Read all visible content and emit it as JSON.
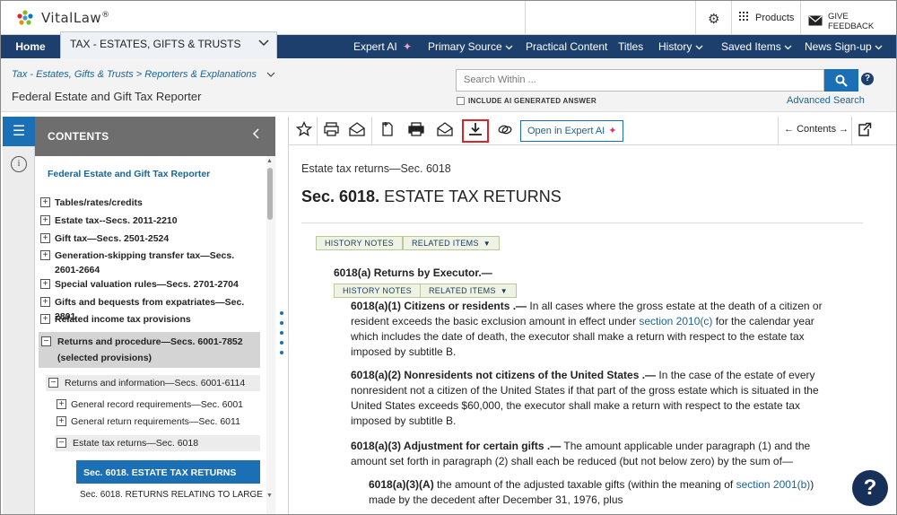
{
  "brand": {
    "name": "VitalLaw",
    "reg": "®"
  },
  "header": {
    "products_label": "Products",
    "feedback_label": "GIVE FEEDBACK"
  },
  "nav": {
    "home": "Home",
    "practice_area": "TAX - ESTATES, GIFTS & TRUSTS",
    "items": [
      "Expert AI",
      "Primary Source",
      "Practical Content",
      "Titles",
      "History",
      "Saved Items",
      "News Sign-up"
    ]
  },
  "subheader": {
    "breadcrumb": "Tax - Estates, Gifts & Trusts > Reporters & Explanations",
    "doc_title": "Federal Estate and Gift Tax Reporter",
    "search_placeholder": "Search Within ...",
    "ai_checkbox_label": "INCLUDE AI GENERATED ANSWER",
    "advanced_search": "Advanced Search"
  },
  "toc": {
    "heading": "CONTENTS",
    "root": "Federal Estate and Gift Tax Reporter",
    "items": [
      "Tables/rates/credits",
      "Estate tax--Secs. 2011-2210",
      "Gift tax—Secs. 2501-2524",
      "Generation-skipping transfer tax—Secs. 2601-2664",
      "Special valuation rules—Secs. 2701-2704",
      "Gifts and bequests from expatriates—Sec. 2801",
      "Related income tax provisions",
      "Returns and procedure—Secs. 6001-7852 (selected provisions)",
      "Returns and information—Secs. 6001-6114",
      "General record requirements—Sec. 6001",
      "General return requirements—Sec. 6011",
      "Estate tax returns—Sec. 6018",
      "Sec. 6018. ESTATE TAX RETURNS",
      "Sec. 6018. RETURNS RELATING TO LARGE"
    ]
  },
  "toolbar": {
    "open_expert_ai": "Open in Expert AI",
    "contents_nav": "Contents"
  },
  "doc": {
    "context": "Estate tax returns—Sec. 6018",
    "sec_num": "Sec. 6018.",
    "sec_name": "ESTATE TAX RETURNS",
    "history_notes": "HISTORY NOTES",
    "related_items": "RELATED ITEMS",
    "p_a_head": "6018(a)  Returns by Executor.—",
    "p1_lead": "6018(a)(1)  Citizens or residents .—",
    "p1_text_1": " In all cases where the gross estate at the death of a citizen or resident exceeds the basic exclusion amount in effect under ",
    "p1_link": "section 2010(c)",
    "p1_text_2": " for the calendar year which includes the date of death, the executor shall make a return with respect to the estate tax imposed by subtitle B.",
    "p2_lead": "6018(a)(2)  Nonresidents not citizens of the United States .—",
    "p2_text": " In the case of the estate of every nonresident not a citizen of the United States if that part of the gross estate which is situated in the United States exceeds $60,000, the executor shall make a return with respect to the estate tax imposed by subtitle B.",
    "p3_lead": "6018(a)(3)  Adjustment for certain gifts .—",
    "p3_text": " The amount applicable under paragraph (1) and the amount set forth in paragraph (2) shall each be reduced (but not below zero) by the sum of—",
    "p4_lead": "6018(a)(3)(A)",
    "p4_text_1": " the amount of the adjusted taxable gifts (within the meaning of ",
    "p4_link": "section 2001(b)",
    "p4_text_2": ") made by the decedent after December 31, 1976, plus"
  },
  "help_fab": "?"
}
